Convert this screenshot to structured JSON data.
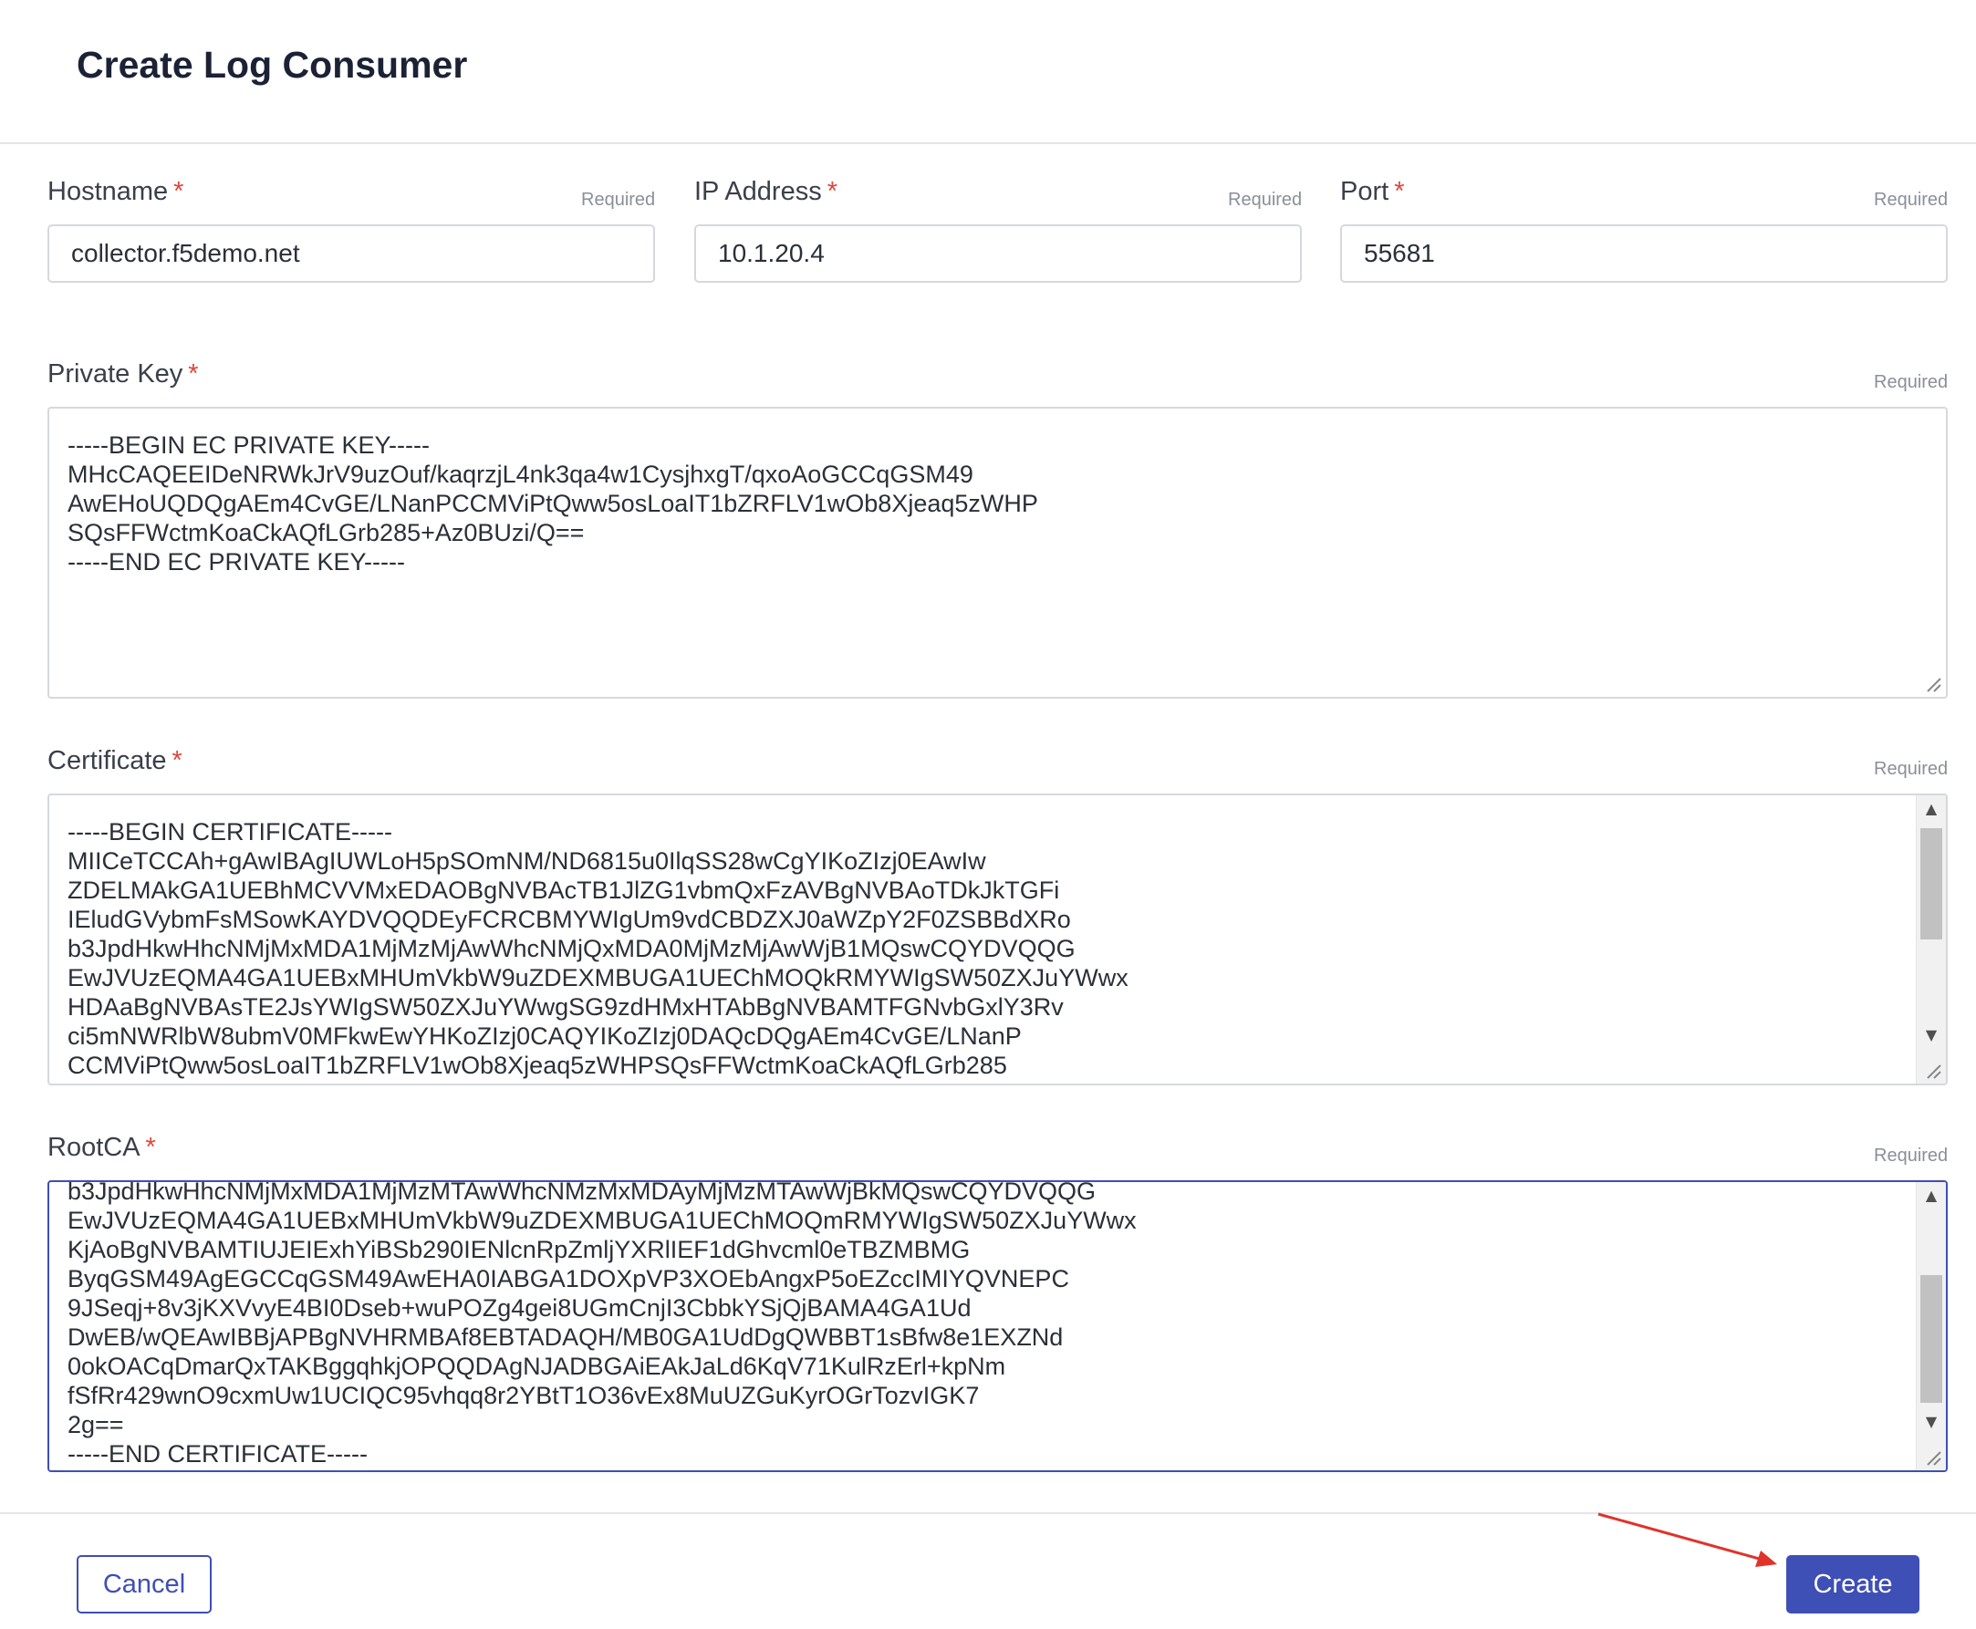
{
  "dialog": {
    "title": "Create Log Consumer"
  },
  "fields": {
    "hostname": {
      "label": "Hostname",
      "required_star": "*",
      "required_hint": "Required",
      "value": "collector.f5demo.net"
    },
    "ip_address": {
      "label": "IP Address",
      "required_star": "*",
      "required_hint": "Required",
      "value": "10.1.20.4"
    },
    "port": {
      "label": "Port",
      "required_star": "*",
      "required_hint": "Required",
      "value": "55681"
    },
    "private_key": {
      "label": "Private Key",
      "required_star": "*",
      "required_hint": "Required",
      "value": "-----BEGIN EC PRIVATE KEY-----\nMHcCAQEEIDeNRWkJrV9uzOuf/kaqrzjL4nk3qa4w1CysjhxgT/qxoAoGCCqGSM49\nAwEHoUQDQgAEm4CvGE/LNanPCCMViPtQww5osLoaIT1bZRFLV1wOb8Xjeaq5zWHP\nSQsFFWctmKoaCkAQfLGrb285+Az0BUzi/Q==\n-----END EC PRIVATE KEY-----"
    },
    "certificate": {
      "label": "Certificate",
      "required_star": "*",
      "required_hint": "Required",
      "value": "-----BEGIN CERTIFICATE-----\nMIICeTCCAh+gAwIBAgIUWLoH5pSOmNM/ND6815u0IlqSS28wCgYIKoZIzj0EAwIw\nZDELMAkGA1UEBhMCVVMxEDAOBgNVBAcTB1JlZG1vbmQxFzAVBgNVBAoTDkJkTGFi\nIEludGVybmFsMSowKAYDVQQDEyFCRCBMYWIgUm9vdCBDZXJ0aWZpY2F0ZSBBdXRo\nb3JpdHkwHhcNMjMxMDA1MjMzMjAwWhcNMjQxMDA0MjMzMjAwWjB1MQswCQYDVQQG\nEwJVUzEQMA4GA1UEBxMHUmVkbW9uZDEXMBUGA1UEChMOQkRMYWIgSW50ZXJuYWwx\nHDAaBgNVBAsTE2JsYWIgSW50ZXJuYWwgSG9zdHMxHTAbBgNVBAMTFGNvbGxlY3Rv\nci5mNWRlbW8ubmV0MFkwEwYHKoZIzj0CAQYIKoZIzj0DAQcDQgAEm4CvGE/LNanP\nCCMViPtQww5osLoaIT1bZRFLV1wOb8Xjeaq5zWHPSQsFFWctmKoaCkAQfLGrb285"
    },
    "root_ca": {
      "label": "RootCA",
      "required_star": "*",
      "required_hint": "Required",
      "value": "b3JpdHkwHhcNMjMxMDA1MjMzMTAwWhcNMzMxMDAyMjMzMTAwWjBkMQswCQYDVQQG\nEwJVUzEQMA4GA1UEBxMHUmVkbW9uZDEXMBUGA1UEChMOQmRMYWIgSW50ZXJuYWwx\nKjAoBgNVBAMTIUJEIExhYiBSb290IENlcnRpZmljYXRlIEF1dGhvcml0eTBZMBMG\nByqGSM49AgEGCCqGSM49AwEHA0IABGA1DOXpVP3XOEbAngxP5oEZccIMIYQVNEPC\n9JSeqj+8v3jKXVvyE4BI0Dseb+wuPOZg4gei8UGmCnjI3CbbkYSjQjBAMA4GA1Ud\nDwEB/wQEAwIBBjAPBgNVHRMBAf8EBTADAQH/MB0GA1UdDgQWBBT1sBfw8e1EXZNd\n0okOACqDmarQxTAKBggqhkjOPQQDAgNJADBGAiEAkJaLd6KqV71KulRzErl+kpNm\nfSfRr429wnO9cxmUw1UCIQC95vhqq8r2YBtT1O36vEx8MuUZGuKyrOGrTozvIGK7\n2g==\n-----END CERTIFICATE-----"
    }
  },
  "footer": {
    "cancel_label": "Cancel",
    "create_label": "Create"
  },
  "colors": {
    "accent": "#3e4fb5",
    "required_star": "#e0453a",
    "annotation_arrow": "#e0332a"
  }
}
